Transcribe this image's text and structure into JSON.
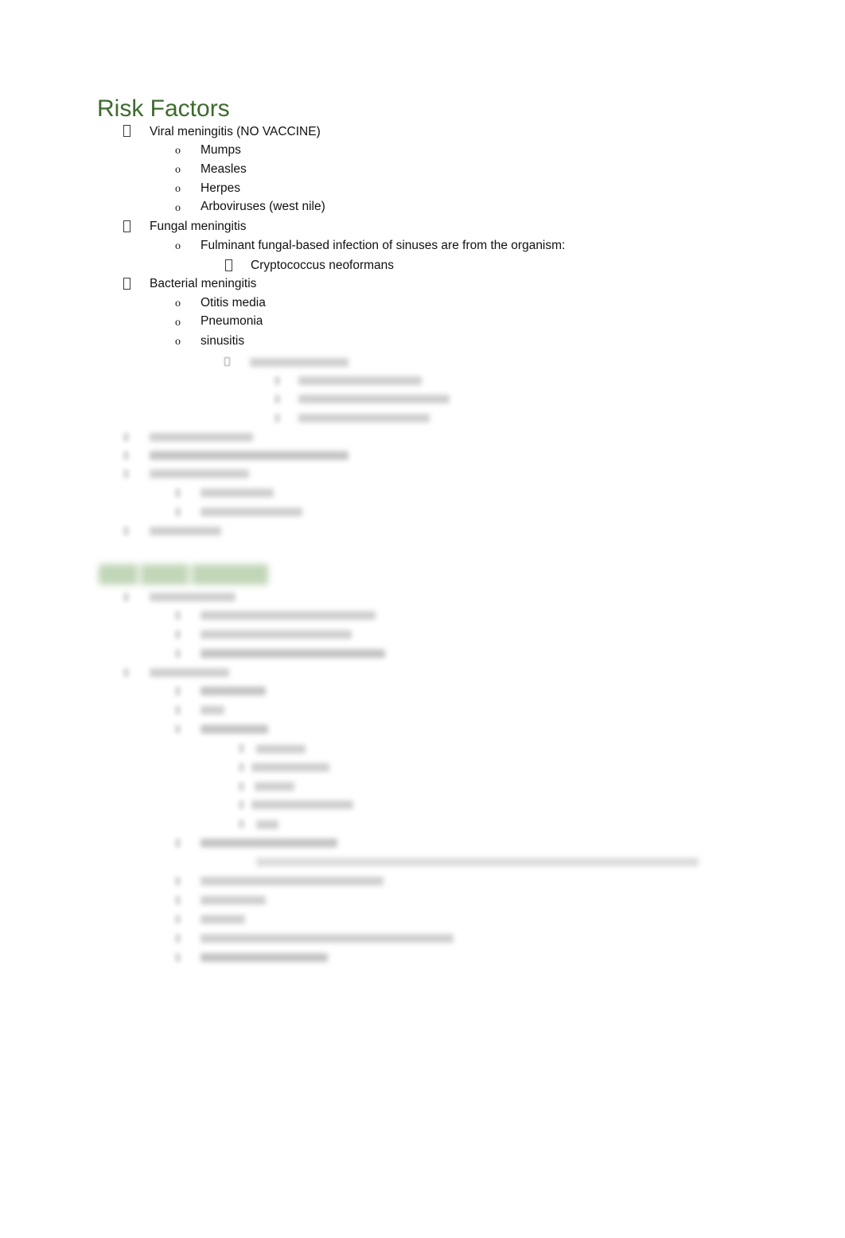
{
  "document": {
    "page_background": "#ffffff",
    "heading_color": "#3d6b2d",
    "redacted_heading_color": "#8fb47e",
    "body_text_color": "#111111"
  },
  "headings": {
    "risk_factors": "Risk Factors",
    "expected_findings": ""
  },
  "outline": [
    {
      "level": 1,
      "bullet": "tofu-box",
      "text": "Viral meningitis (NO VACCINE)",
      "legible": true
    },
    {
      "level": 2,
      "bullet": "o",
      "text": "Mumps",
      "legible": true
    },
    {
      "level": 2,
      "bullet": "o",
      "text": "Measles",
      "legible": true
    },
    {
      "level": 2,
      "bullet": "o",
      "text": "Herpes",
      "legible": true
    },
    {
      "level": 2,
      "bullet": "o",
      "text": "Arboviruses (west nile)",
      "legible": true
    },
    {
      "level": 1,
      "bullet": "tofu-box",
      "text": "Fungal meningitis",
      "legible": true
    },
    {
      "level": 2,
      "bullet": "o",
      "text": "Fulminant fungal-based infection of sinuses are from the organism:",
      "legible": true
    },
    {
      "level": 3,
      "bullet": "tofu-box",
      "text": "Cryptococcus neoformans",
      "legible": true
    },
    {
      "level": 1,
      "bullet": "tofu-box",
      "text": "Bacterial meningitis",
      "legible": true
    },
    {
      "level": 2,
      "bullet": "o",
      "text": "Otitis media",
      "legible": true
    },
    {
      "level": 2,
      "bullet": "o",
      "text": "Pneumonia",
      "legible": true
    },
    {
      "level": 2,
      "bullet": "o",
      "text": "sinusitis",
      "legible": true
    },
    {
      "level": 3,
      "bullet": "tofu-box",
      "text": "",
      "legible": false
    },
    {
      "level": 4,
      "bullet": "tofu-box",
      "text": "",
      "legible": false
    },
    {
      "level": 4,
      "bullet": "tofu-box",
      "text": "",
      "legible": false
    },
    {
      "level": 4,
      "bullet": "tofu-box",
      "text": "",
      "legible": false
    },
    {
      "level": 1,
      "bullet": "tofu-box",
      "text": "",
      "legible": false
    },
    {
      "level": 1,
      "bullet": "tofu-box",
      "text": "",
      "legible": false
    },
    {
      "level": 1,
      "bullet": "tofu-box",
      "text": "",
      "legible": false
    },
    {
      "level": 2,
      "bullet": "o",
      "text": "",
      "legible": false
    },
    {
      "level": 2,
      "bullet": "o",
      "text": "",
      "legible": false
    },
    {
      "level": 1,
      "bullet": "tofu-box",
      "text": "",
      "legible": false
    },
    {
      "level": 1,
      "bullet": "tofu-box",
      "text": "",
      "legible": false
    },
    {
      "level": 2,
      "bullet": "o",
      "text": "",
      "legible": false
    },
    {
      "level": 2,
      "bullet": "o",
      "text": "",
      "legible": false
    },
    {
      "level": 2,
      "bullet": "o",
      "text": "",
      "legible": false
    },
    {
      "level": 1,
      "bullet": "tofu-box",
      "text": "",
      "legible": false
    },
    {
      "level": 2,
      "bullet": "o",
      "text": "",
      "legible": false
    },
    {
      "level": 2,
      "bullet": "o",
      "text": "",
      "legible": false
    },
    {
      "level": 2,
      "bullet": "o",
      "text": "",
      "legible": false
    },
    {
      "level": 3,
      "bullet": "tofu-box",
      "text": "",
      "legible": false
    },
    {
      "level": 3,
      "bullet": "tofu-box",
      "text": "",
      "legible": false
    },
    {
      "level": 3,
      "bullet": "tofu-box",
      "text": "",
      "legible": false
    },
    {
      "level": 3,
      "bullet": "tofu-box",
      "text": "",
      "legible": false
    },
    {
      "level": 3,
      "bullet": "tofu-box",
      "text": "",
      "legible": false
    },
    {
      "level": 2,
      "bullet": "o",
      "text": "",
      "legible": false
    },
    {
      "level": 3,
      "bullet": "tofu-box",
      "text": "",
      "legible": false
    },
    {
      "level": 2,
      "bullet": "o",
      "text": "",
      "legible": false
    },
    {
      "level": 2,
      "bullet": "o",
      "text": "",
      "legible": false
    },
    {
      "level": 2,
      "bullet": "o",
      "text": "",
      "legible": false
    },
    {
      "level": 2,
      "bullet": "o",
      "text": "",
      "legible": false
    },
    {
      "level": 2,
      "bullet": "o",
      "text": "",
      "legible": false
    }
  ]
}
